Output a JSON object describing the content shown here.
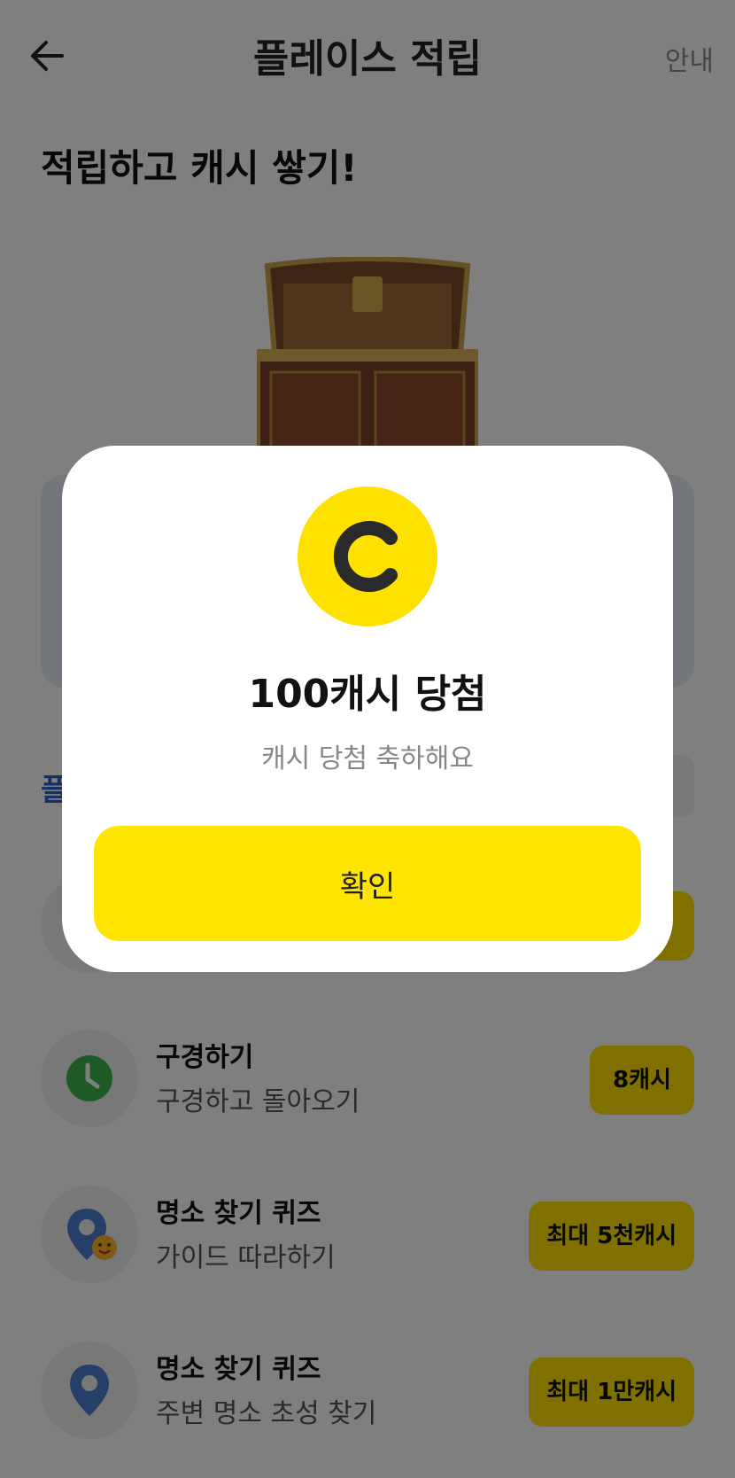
{
  "header": {
    "title": "플레이스 적립",
    "guide_label": "안내"
  },
  "headline": "적립하고 캐시 쌓기!",
  "section_label": "플",
  "list": [
    {
      "title": "구경하기",
      "subtitle": "구경하고 돌아오기",
      "reward": "8캐시",
      "icon": "clock-icon"
    },
    {
      "title": "명소 찾기 퀴즈",
      "subtitle": "가이드 따라하기",
      "reward": "최대 5천캐시",
      "icon": "location-smile-icon"
    },
    {
      "title": "명소 찾기 퀴즈",
      "subtitle": "주변 명소 초성 찾기",
      "reward": "최대 1만캐시",
      "icon": "location-pin-icon"
    }
  ],
  "modal": {
    "coin_letter": "C",
    "title": "100캐시 당첨",
    "subtitle": "캐시 당첨 축하해요",
    "confirm_label": "확인"
  },
  "colors": {
    "accent_yellow": "#ffe100",
    "link_blue": "#2a62c9",
    "clock_green": "#3bb54a",
    "pin_blue": "#4a7fd0"
  }
}
